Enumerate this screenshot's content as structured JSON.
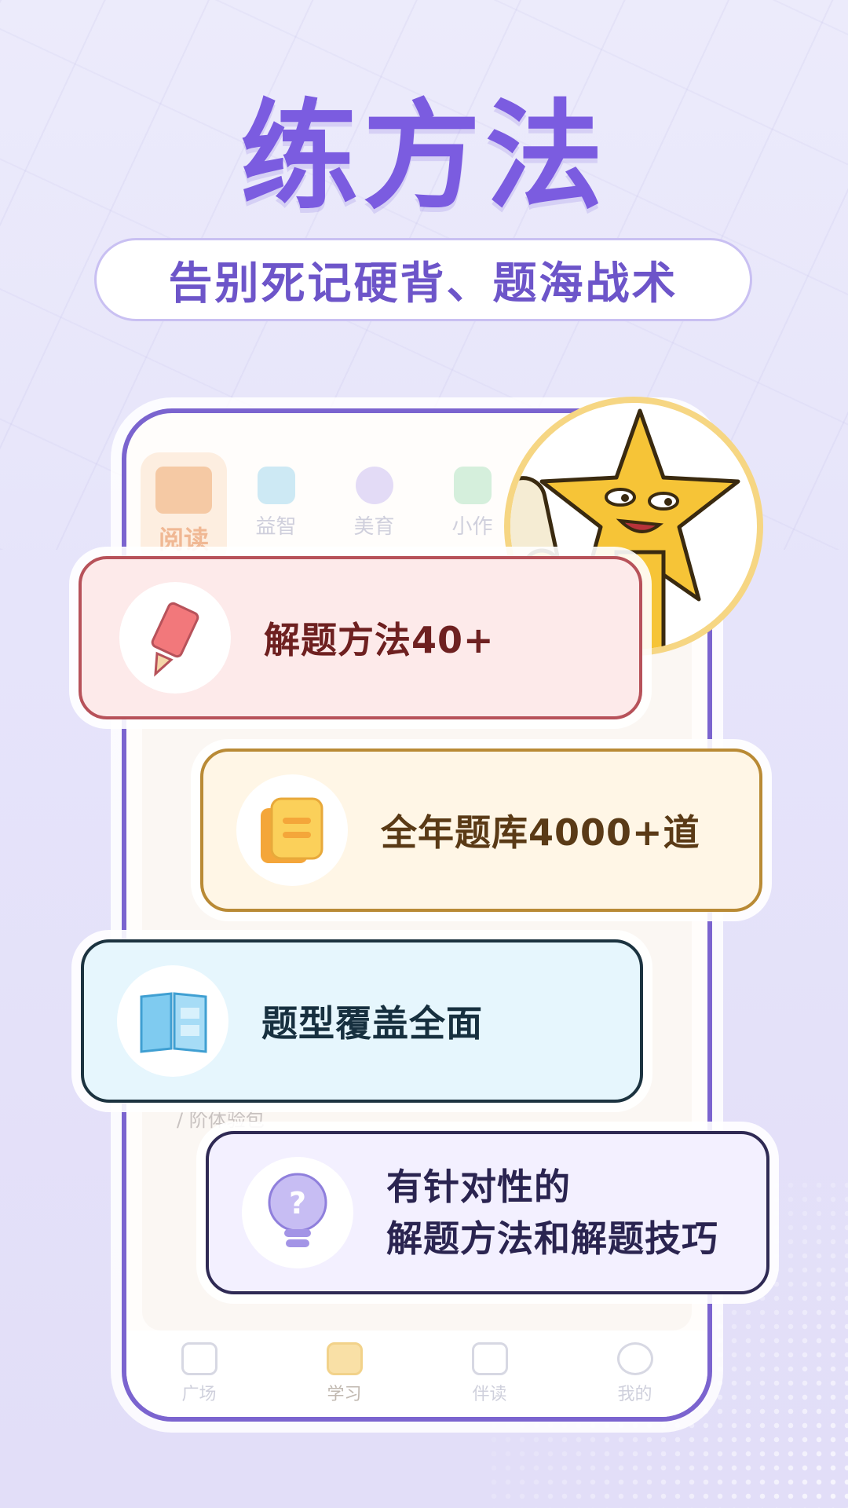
{
  "headline": {
    "title": "练方法",
    "subtitle": "告别死记硬背、题海战术"
  },
  "phone": {
    "tabs": [
      {
        "label": "阅读",
        "active": true,
        "icon": "book-icon"
      },
      {
        "label": "益智",
        "active": false,
        "icon": "cube-icon"
      },
      {
        "label": "美育",
        "active": false,
        "icon": "moon-icon"
      },
      {
        "label": "小作",
        "active": false,
        "icon": "pen-icon"
      }
    ],
    "hint_text": "/ 阶体验包",
    "bottom_nav": [
      {
        "label": "广场",
        "icon": "home-icon",
        "active": false
      },
      {
        "label": "学习",
        "icon": "book-icon",
        "active": true
      },
      {
        "label": "伴读",
        "icon": "bag-icon",
        "active": false
      },
      {
        "label": "我的",
        "icon": "smile-icon",
        "active": false
      }
    ]
  },
  "features": [
    {
      "label": "解题方法40+",
      "icon": "pencil-icon"
    },
    {
      "label": "全年题库4000+道",
      "icon": "stacked-notes-icon"
    },
    {
      "label": "题型覆盖全面",
      "icon": "open-book-icon"
    },
    {
      "label_line1": "有针对性的",
      "label_line2": "解题方法和解题技巧",
      "icon": "lightbulb-question-icon"
    }
  ],
  "colors": {
    "title": "#7b5ce0",
    "accent": "#6d55c9",
    "phone_frame": "#7b64cf",
    "star": "#f6c437"
  }
}
